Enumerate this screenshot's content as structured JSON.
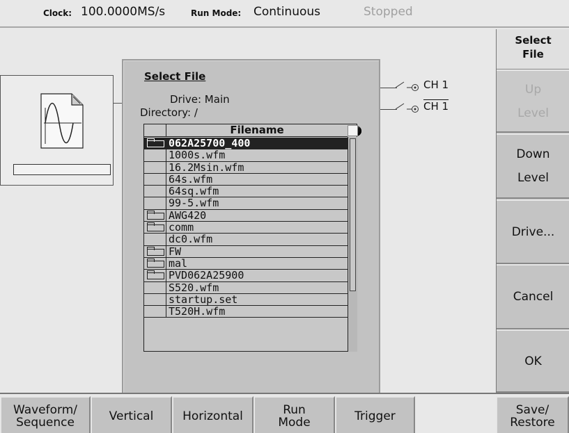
{
  "status": {
    "clock_label": "Clock:",
    "clock_value": "100.0000MS/s",
    "runmode_label": "Run Mode:",
    "runmode_value": "Continuous",
    "state": "Stopped"
  },
  "channels": {
    "ch1": "CH 1",
    "ch1_bar": "CH 1"
  },
  "dialog": {
    "title": "Select File",
    "drive": "Drive: Main",
    "directory": "Directory: /",
    "column_header": "Filename",
    "files": [
      {
        "name": "062A25700_400",
        "folder": true,
        "selected": true
      },
      {
        "name": "1000s.wfm",
        "folder": false
      },
      {
        "name": "16.2Msin.wfm",
        "folder": false
      },
      {
        "name": "64s.wfm",
        "folder": false
      },
      {
        "name": "64sq.wfm",
        "folder": false
      },
      {
        "name": "99-5.wfm",
        "folder": false
      },
      {
        "name": "AWG420",
        "folder": true
      },
      {
        "name": "comm",
        "folder": true
      },
      {
        "name": "dc0.wfm",
        "folder": false
      },
      {
        "name": "FW",
        "folder": true
      },
      {
        "name": "mal",
        "folder": true
      },
      {
        "name": "PVD062A25900",
        "folder": true
      },
      {
        "name": "S520.wfm",
        "folder": false
      },
      {
        "name": "startup.set",
        "folder": false
      },
      {
        "name": "T520H.wfm",
        "folder": false
      }
    ]
  },
  "side_menu": {
    "title": "Select\nFile",
    "up_level": "Up\nLevel",
    "down_level": "Down\nLevel",
    "drive": "Drive...",
    "cancel": "Cancel",
    "ok": "OK"
  },
  "bottom_menu": {
    "waveform_sequence": "Waveform/\nSequence",
    "vertical": "Vertical",
    "horizontal": "Horizontal",
    "run_mode": "Run\nMode",
    "trigger": "Trigger",
    "save_restore": "Save/\nRestore"
  }
}
